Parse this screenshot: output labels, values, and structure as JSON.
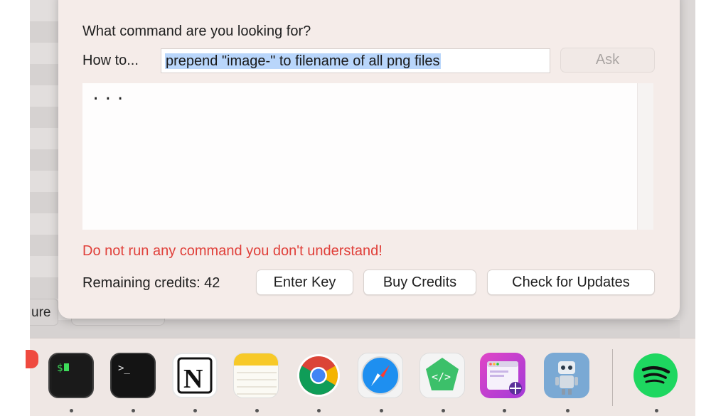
{
  "background_app": {
    "visible_tab_fragment": "ure"
  },
  "dialog": {
    "prompt": "What command are you looking for?",
    "howto_label": "How to...",
    "query": "prepend \"image-\" to filename of all png files",
    "ask_label": "Ask",
    "output": "...",
    "warning": "Do not run any command you don't understand!",
    "credits_text": "Remaining credits: 42",
    "buttons": {
      "enter_key": "Enter Key",
      "buy_credits": "Buy Credits",
      "check_updates": "Check for Updates"
    }
  },
  "dock": {
    "apps": [
      {
        "name": "terminal-green-prompt",
        "icon": "terminal-icon",
        "glyph": "$▯"
      },
      {
        "name": "terminal",
        "icon": "terminal-icon",
        "glyph": ">_"
      },
      {
        "name": "notion",
        "icon": "notion-icon",
        "glyph": "N"
      },
      {
        "name": "notes",
        "icon": "notes-icon"
      },
      {
        "name": "chrome",
        "icon": "chrome-icon"
      },
      {
        "name": "safari",
        "icon": "safari-icon"
      },
      {
        "name": "code-editor",
        "icon": "code-icon",
        "glyph": "</>"
      },
      {
        "name": "screenshot-app",
        "icon": "screenshot-app-icon"
      },
      {
        "name": "robot-app",
        "icon": "robot-icon"
      },
      {
        "name": "spotify",
        "icon": "spotify-icon"
      }
    ]
  },
  "colors": {
    "dialog_bg": "#f5ece9",
    "selection": "#b9d6fb",
    "warning": "#e0403a",
    "spotify_green": "#1ed760"
  }
}
